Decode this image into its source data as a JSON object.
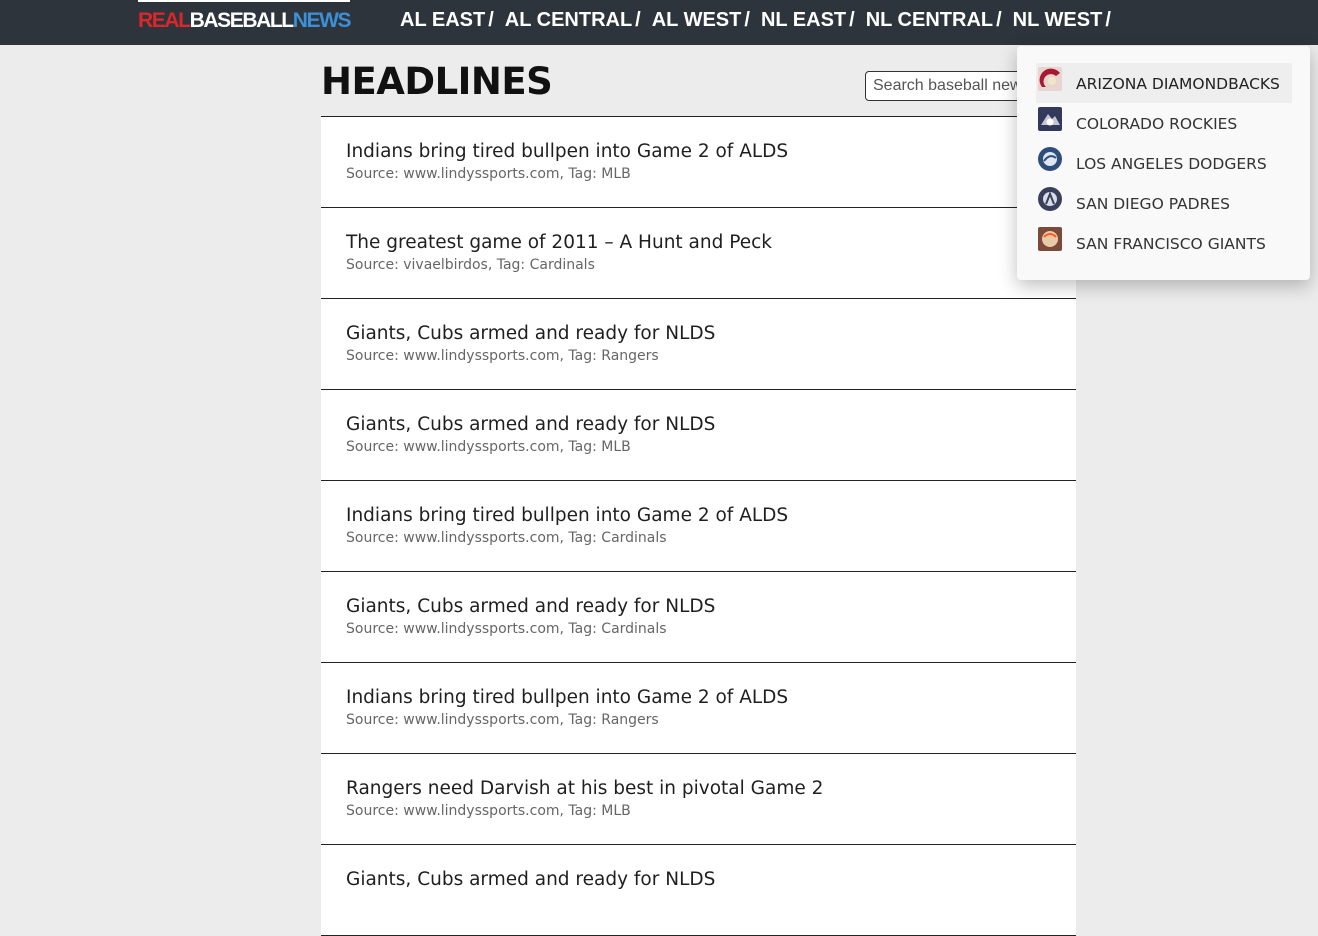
{
  "brand": {
    "part1": "REAL",
    "part2": "BASEBALL",
    "part3": "NEWS"
  },
  "nav": [
    {
      "label": "AL EAST",
      "sep": "/"
    },
    {
      "label": "AL CENTRAL",
      "sep": "/"
    },
    {
      "label": "AL WEST",
      "sep": "/"
    },
    {
      "label": "NL EAST",
      "sep": "/"
    },
    {
      "label": "NL CENTRAL",
      "sep": "/"
    },
    {
      "label": "NL WEST",
      "sep": "/"
    }
  ],
  "main": {
    "title": "HEADLINES",
    "search_placeholder": "Search baseball news"
  },
  "headlines": [
    {
      "title": "Indians bring tired bullpen into Game 2 of ALDS",
      "meta": "Source: www.lindyssports.com, Tag: MLB"
    },
    {
      "title": "The greatest game of 2011 – A Hunt and Peck",
      "meta": "Source: vivaelbirdos, Tag: Cardinals"
    },
    {
      "title": "Giants, Cubs armed and ready for NLDS",
      "meta": "Source: www.lindyssports.com, Tag: Rangers"
    },
    {
      "title": "Giants, Cubs armed and ready for NLDS",
      "meta": "Source: www.lindyssports.com, Tag: MLB"
    },
    {
      "title": "Indians bring tired bullpen into Game 2 of ALDS",
      "meta": "Source: www.lindyssports.com, Tag: Cardinals"
    },
    {
      "title": "Giants, Cubs armed and ready for NLDS",
      "meta": "Source: www.lindyssports.com, Tag: Cardinals"
    },
    {
      "title": "Indians bring tired bullpen into Game 2 of ALDS",
      "meta": "Source: www.lindyssports.com, Tag: Rangers"
    },
    {
      "title": "Rangers need Darvish at his best in pivotal Game 2",
      "meta": "Source: www.lindyssports.com, Tag: MLB"
    },
    {
      "title": "Giants, Cubs armed and ready for NLDS",
      "meta": ""
    }
  ],
  "dropdown": {
    "teams": [
      {
        "name": "ARIZONA DIAMONDBACKS",
        "icon": "diamondbacks-logo-icon",
        "color": "#a71930",
        "active": true
      },
      {
        "name": "COLORADO ROCKIES",
        "icon": "rockies-logo-icon",
        "color": "#33006f",
        "active": false
      },
      {
        "name": "LOS ANGELES DODGERS",
        "icon": "dodgers-logo-icon",
        "color": "#005a9c",
        "active": false
      },
      {
        "name": "SAN DIEGO PADRES",
        "icon": "padres-logo-icon",
        "color": "#2f3b67",
        "active": false
      },
      {
        "name": "SAN FRANCISCO GIANTS",
        "icon": "giants-logo-icon",
        "color": "#fd5a1e",
        "active": false
      }
    ]
  },
  "colors": {
    "topbar": "#2d343c",
    "brand_red": "#d9272a",
    "brand_blue": "#3d8fd6"
  }
}
